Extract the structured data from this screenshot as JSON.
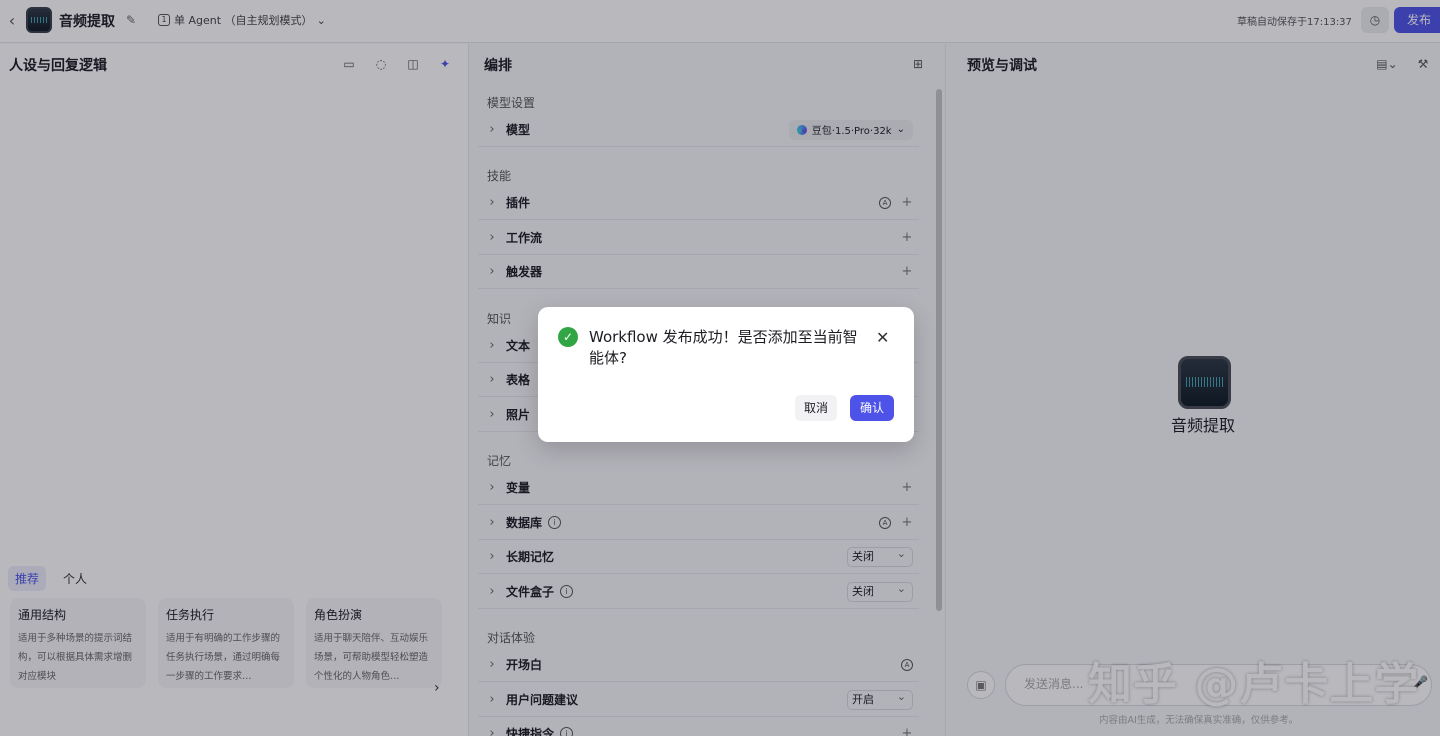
{
  "header": {
    "app_title": "音频提取",
    "mode_label": "单 Agent （自主规划模式）",
    "autosave": "草稿自动保存于17:13:37",
    "publish_label": "发布"
  },
  "left_panel": {
    "title": "人设与回复逻辑",
    "tabs": [
      "推荐",
      "个人"
    ],
    "cards": [
      {
        "title": "通用结构",
        "desc": "适用于多种场景的提示词结构，可以根据具体需求增删对应模块"
      },
      {
        "title": "任务执行",
        "desc": "适用于有明确的工作步骤的任务执行场景，通过明确每一步骤的工作要求…"
      },
      {
        "title": "角色扮演",
        "desc": "适用于聊天陪伴、互动娱乐场景，可帮助模型轻松塑造个性化的人物角色…"
      }
    ]
  },
  "mid_panel": {
    "title": "编排",
    "sections": {
      "model_settings": "模型设置",
      "skills": "技能",
      "knowledge": "知识",
      "memory": "记忆",
      "dialog_exp": "对话体验"
    },
    "model_row": {
      "label": "模型",
      "value": "豆包·1.5·Pro·32k"
    },
    "skill_rows": [
      "插件",
      "工作流",
      "触发器"
    ],
    "knowledge_rows": [
      "文本",
      "表格",
      "照片"
    ],
    "memory_rows": {
      "variables": "变量",
      "database": "数据库",
      "long_memory": "长期记忆",
      "long_memory_value": "关闭",
      "file_box": "文件盒子",
      "file_box_value": "关闭"
    },
    "dialog_rows": {
      "opener": "开场白",
      "suggestions": "用户问题建议",
      "suggestions_value": "开启",
      "shortcuts": "快捷指令"
    }
  },
  "right_panel": {
    "title": "预览与调试",
    "bot_name": "音频提取",
    "input_placeholder": "发送消息...",
    "disclaimer": "内容由AI生成，无法确保真实准确，仅供参考。",
    "watermark": "知乎 @卢卡上学"
  },
  "dialog": {
    "message": "Workflow 发布成功！是否添加至当前智能体?",
    "cancel": "取消",
    "confirm": "确认"
  }
}
